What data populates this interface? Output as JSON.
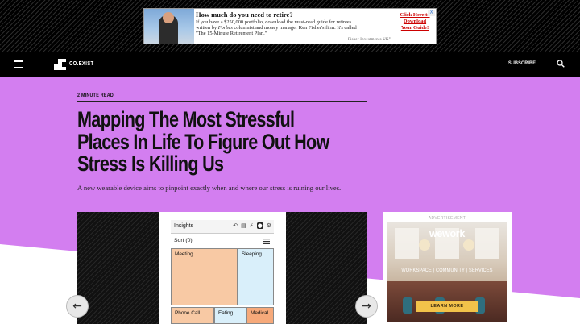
{
  "top_ad": {
    "headline": "How much do you need to retire?",
    "body_1": "If you have a $250,000 portfolio, download the must-read guide for retirees",
    "body_2a": "written by ",
    "body_2b": "Forbes",
    "body_2c": " columnist and money manager Ken Fisher's firm. It's called",
    "body_3": "\"The 15-Minute Retirement Plan.\"",
    "cta": "Click Here to Download Your Guide!",
    "sponsor": "Fisher Investments UK°",
    "close": "X"
  },
  "nav": {
    "logo_text": "CO.EXIST",
    "subscribe": "SUBSCRIBE",
    "menu_icon": "hamburger-menu-icon",
    "search_icon": "search-icon"
  },
  "article": {
    "read_time": "2 MINUTE READ",
    "headline": "Mapping The Most Stressful Places In Life To Figure Out How Stress Is Killing Us",
    "dek": "A new wearable device aims to pinpoint exactly when and where our stress is ruining our lives."
  },
  "app_screen": {
    "title": "Insights",
    "sort": "Sort (0)",
    "tiles": [
      "Meeting",
      "Sleeping",
      "Phone Call",
      "Eating",
      "Medical"
    ]
  },
  "side_ad": {
    "label": "ADVERTISEMENT",
    "brand": "wework",
    "tagline": "WORKSPACE | COMMUNITY | SERVICES",
    "cta": "LEARN MORE"
  },
  "colors": {
    "hero_bg": "#d37ef0",
    "nav_bg": "#000000",
    "tile_meeting": "#f8c9a4",
    "tile_sleeping": "#d9effa",
    "tile_eating": "#d9effa",
    "tile_medical": "#f6a97a",
    "cta_red": "#cc0000",
    "wework_button": "#f2c24a"
  }
}
